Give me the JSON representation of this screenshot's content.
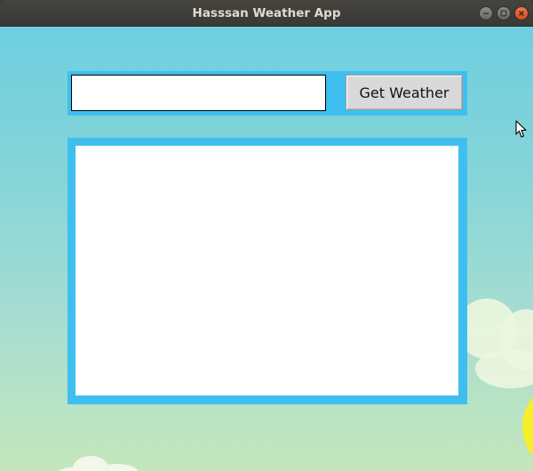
{
  "window": {
    "title": "Hasssan Weather App",
    "controls": {
      "minimize_icon": "minimize-icon",
      "maximize_icon": "maximize-icon",
      "close_icon": "close-icon"
    }
  },
  "search": {
    "city_value": "",
    "placeholder": "",
    "button_label": "Get Weather"
  },
  "result": {
    "text": ""
  },
  "colors": {
    "frame_accent": "#3fbfef",
    "sky_top": "#6ecfe0",
    "sky_bottom": "#c4e7bc",
    "sun": "#f6ef2a",
    "close_button": "#e95420"
  }
}
